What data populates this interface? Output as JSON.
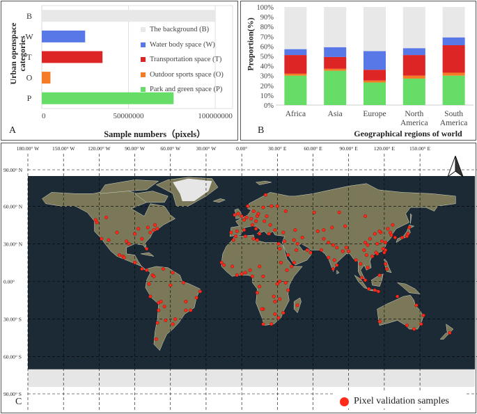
{
  "chart_data": [
    {
      "id": "A",
      "type": "bar",
      "orientation": "horizontal",
      "panel_label": "A",
      "title": "",
      "ylabel": "Urban openspace categories",
      "xlabel": "Sample numbers（pixels）",
      "categories": [
        "B",
        "W",
        "T",
        "O",
        "P"
      ],
      "values": [
        100000000,
        25000000,
        35000000,
        5000000,
        76000000
      ],
      "colors": [
        "#e8e8e8",
        "#5878e8",
        "#dd2525",
        "#f57b25",
        "#66dd66"
      ],
      "xlim": [
        0,
        110000000
      ],
      "xticks": [
        0,
        50000000,
        100000000
      ],
      "xtick_labels": [
        "0",
        "50000000",
        "100000000"
      ],
      "grid": "vertical",
      "legend": {
        "placement": "right",
        "entries": [
          {
            "label": "The background (B)",
            "color": "#e8e8e8"
          },
          {
            "label": "Water body space (W)",
            "color": "#5878e8"
          },
          {
            "label": "Transportation space (T)",
            "color": "#dd2525"
          },
          {
            "label": "Outdoor sports space (O)",
            "color": "#f57b25"
          },
          {
            "label": "Park and green space (P)",
            "color": "#66dd66"
          }
        ]
      }
    },
    {
      "id": "B",
      "type": "bar",
      "stacked": true,
      "panel_label": "B",
      "title": "",
      "ylabel": "Proportion(%)",
      "xlabel": "Geographical regions of world",
      "categories": [
        "Africa",
        "Asia",
        "Europe",
        "North America",
        "South America"
      ],
      "category_lines": [
        [
          "Africa"
        ],
        [
          "Asia"
        ],
        [
          "Europe"
        ],
        [
          "North",
          "America"
        ],
        [
          "South",
          "America"
        ]
      ],
      "ylim": [
        0,
        100
      ],
      "yticks": [
        0,
        10,
        20,
        30,
        40,
        50,
        60,
        70,
        80,
        90,
        100
      ],
      "ytick_labels": [
        "0%",
        "10%",
        "20%",
        "30%",
        "40%",
        "50%",
        "60%",
        "70%",
        "80%",
        "90%",
        "100%"
      ],
      "series": [
        {
          "key": "P",
          "color": "#66dd66",
          "values": [
            30,
            35,
            23,
            27,
            30
          ]
        },
        {
          "key": "O",
          "color": "#f57b25",
          "values": [
            2,
            2,
            2,
            3,
            3
          ]
        },
        {
          "key": "T",
          "color": "#dd2525",
          "values": [
            19,
            12,
            11,
            21,
            28
          ]
        },
        {
          "key": "W",
          "color": "#5878e8",
          "values": [
            6,
            10,
            19,
            7,
            8
          ]
        },
        {
          "key": "B",
          "color": "#e8e8e8",
          "values": [
            43,
            41,
            45,
            42,
            31
          ]
        }
      ]
    }
  ],
  "map": {
    "panel_label": "C",
    "top_lon_labels": [
      "180.00° W",
      "150.00° W",
      "120.00° W",
      "90.00° W",
      "60.00° W",
      "30.00° W",
      "0.00°",
      "30.00° E",
      "60.00° E",
      "90.00° E",
      "120.00° E",
      "150.00° E"
    ],
    "top_lon_values": [
      -180,
      -150,
      -120,
      -90,
      -60,
      -30,
      0,
      30,
      60,
      90,
      120,
      150
    ],
    "lat_labels": [
      "90.00° N",
      "60.00° N",
      "30.00° N",
      "0.00°",
      "30.00° S",
      "60.00° S",
      "90.00° S"
    ],
    "lat_values": [
      90,
      60,
      30,
      0,
      -30,
      -60,
      -90
    ],
    "legend_label": "Pixel validation samples",
    "ocean_color": "#1b2a35",
    "land_color": "#7a7858",
    "ice_color": "#e6e6e6",
    "sample_color": "#ff2a1a",
    "north_arrow": "north-arrow-icon",
    "samples": [
      [
        -122,
        47
      ],
      [
        -118,
        34
      ],
      [
        -112,
        33
      ],
      [
        -105,
        39
      ],
      [
        -97,
        32
      ],
      [
        -95,
        30
      ],
      [
        -90,
        38
      ],
      [
        -87,
        42
      ],
      [
        -84,
        34
      ],
      [
        -80,
        26
      ],
      [
        -77,
        39
      ],
      [
        -74,
        41
      ],
      [
        -71,
        42
      ],
      [
        -79,
        43
      ],
      [
        -73,
        45
      ],
      [
        -114,
        51
      ],
      [
        -123,
        49
      ],
      [
        -100,
        20
      ],
      [
        -99,
        19
      ],
      [
        -103,
        21
      ],
      [
        -90,
        15
      ],
      [
        -84,
        10
      ],
      [
        -80,
        9
      ],
      [
        -75,
        5
      ],
      [
        -74,
        4
      ],
      [
        -66,
        10
      ],
      [
        -58,
        7
      ],
      [
        -78,
        -2
      ],
      [
        -77,
        -12
      ],
      [
        -70,
        -17
      ],
      [
        -68,
        -16
      ],
      [
        -65,
        -20
      ],
      [
        -71,
        -33
      ],
      [
        -70,
        -23
      ],
      [
        -64,
        -31
      ],
      [
        -58,
        -34
      ],
      [
        -56,
        -30
      ],
      [
        -47,
        -23
      ],
      [
        -43,
        -23
      ],
      [
        -47,
        -16
      ],
      [
        -38,
        -13
      ],
      [
        -35,
        -8
      ],
      [
        -60,
        -3
      ],
      [
        -49,
        -1
      ],
      [
        -72,
        -46
      ],
      [
        -9,
        39
      ],
      [
        -4,
        40
      ],
      [
        2,
        41
      ],
      [
        2,
        49
      ],
      [
        0,
        52
      ],
      [
        -3,
        54
      ],
      [
        -6,
        53
      ],
      [
        4,
        51
      ],
      [
        8,
        50
      ],
      [
        12,
        48
      ],
      [
        13,
        52
      ],
      [
        10,
        56
      ],
      [
        18,
        59
      ],
      [
        25,
        60
      ],
      [
        30,
        60
      ],
      [
        37,
        56
      ],
      [
        21,
        52
      ],
      [
        19,
        48
      ],
      [
        24,
        45
      ],
      [
        28,
        41
      ],
      [
        12,
        42
      ],
      [
        9,
        45
      ],
      [
        15,
        38
      ],
      [
        23,
        38
      ],
      [
        14,
        54
      ],
      [
        5,
        60
      ],
      [
        20,
        69
      ],
      [
        -5,
        36
      ],
      [
        -7,
        33
      ],
      [
        3,
        36
      ],
      [
        10,
        34
      ],
      [
        13,
        33
      ],
      [
        31,
        30
      ],
      [
        32,
        26
      ],
      [
        45,
        41
      ],
      [
        36,
        32
      ],
      [
        35,
        39
      ],
      [
        44,
        33
      ],
      [
        51,
        35
      ],
      [
        47,
        30
      ],
      [
        46,
        25
      ],
      [
        39,
        21
      ],
      [
        55,
        25
      ],
      [
        58,
        23
      ],
      [
        44,
        15
      ],
      [
        69,
        34
      ],
      [
        67,
        25
      ],
      [
        73,
        31
      ],
      [
        77,
        29
      ],
      [
        80,
        27
      ],
      [
        88,
        27
      ],
      [
        85,
        24
      ],
      [
        73,
        19
      ],
      [
        78,
        17
      ],
      [
        80,
        13
      ],
      [
        77,
        10
      ],
      [
        90,
        24
      ],
      [
        96,
        17
      ],
      [
        100,
        14
      ],
      [
        105,
        21
      ],
      [
        106,
        11
      ],
      [
        101,
        3
      ],
      [
        104,
        1
      ],
      [
        107,
        -6
      ],
      [
        112,
        -7
      ],
      [
        115,
        -8
      ],
      [
        121,
        14
      ],
      [
        122,
        10
      ],
      [
        116,
        5
      ],
      [
        114,
        22
      ],
      [
        120,
        23
      ],
      [
        121,
        25
      ],
      [
        113,
        23
      ],
      [
        110,
        20
      ],
      [
        119,
        26
      ],
      [
        121,
        31
      ],
      [
        118,
        32
      ],
      [
        114,
        30
      ],
      [
        117,
        39
      ],
      [
        116,
        40
      ],
      [
        112,
        38
      ],
      [
        108,
        34
      ],
      [
        104,
        31
      ],
      [
        106,
        29
      ],
      [
        103,
        25
      ],
      [
        126,
        37
      ],
      [
        129,
        35
      ],
      [
        127,
        45
      ],
      [
        123,
        42
      ],
      [
        125,
        39
      ],
      [
        135,
        35
      ],
      [
        139,
        36
      ],
      [
        140,
        38
      ],
      [
        141,
        43
      ],
      [
        87,
        44
      ],
      [
        76,
        43
      ],
      [
        69,
        41
      ],
      [
        61,
        55
      ],
      [
        82,
        55
      ],
      [
        104,
        52
      ],
      [
        64,
        40
      ],
      [
        -17,
        15
      ],
      [
        -15,
        13
      ],
      [
        -8,
        12
      ],
      [
        -4,
        5
      ],
      [
        0,
        6
      ],
      [
        3,
        7
      ],
      [
        7,
        9
      ],
      [
        9,
        4
      ],
      [
        15,
        12
      ],
      [
        18,
        4
      ],
      [
        15,
        -4
      ],
      [
        13,
        -9
      ],
      [
        27,
        -12
      ],
      [
        28,
        -16
      ],
      [
        32,
        -14
      ],
      [
        30,
        -2
      ],
      [
        32,
        0
      ],
      [
        37,
        -1
      ],
      [
        39,
        -7
      ],
      [
        38,
        9
      ],
      [
        42,
        12
      ],
      [
        33,
        15
      ],
      [
        18,
        -22
      ],
      [
        17,
        -22
      ],
      [
        28,
        -26
      ],
      [
        31,
        -29
      ],
      [
        18,
        -34
      ],
      [
        25,
        -34
      ],
      [
        47,
        -19
      ],
      [
        35,
        -25
      ],
      [
        116,
        -32
      ],
      [
        131,
        -12
      ],
      [
        139,
        -35
      ],
      [
        145,
        -38
      ],
      [
        151,
        -34
      ],
      [
        153,
        -27
      ],
      [
        147,
        -19
      ],
      [
        175,
        -41
      ]
    ]
  }
}
